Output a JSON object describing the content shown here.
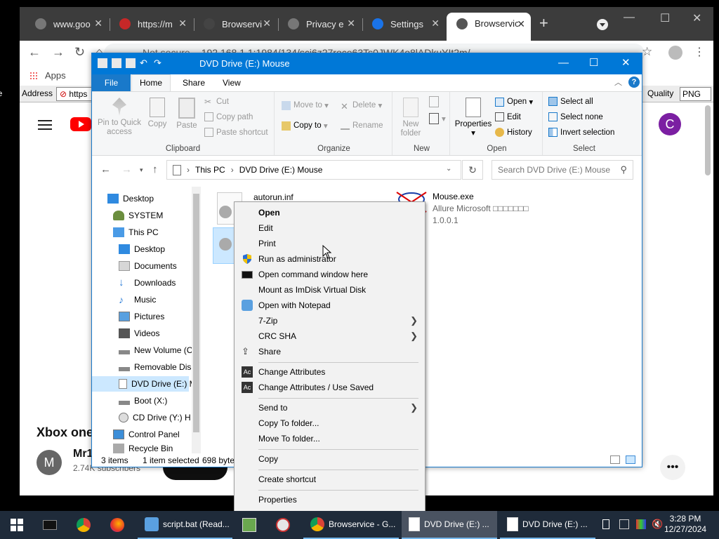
{
  "browser": {
    "tabs": [
      {
        "label": "www.goo",
        "favicon": "globe-icon"
      },
      {
        "label": "https://m",
        "favicon": "gmail-icon"
      },
      {
        "label": "Browservi",
        "favicon": "globe-icon"
      },
      {
        "label": "Privacy e",
        "favicon": "globe-icon"
      },
      {
        "label": "Settings",
        "favicon": "gear-icon"
      },
      {
        "label": "Browservic",
        "favicon": "globe-icon"
      }
    ],
    "security_label": "Not secure",
    "url": "192.168.1.1:1984/134/sci6z27roce63Ts0JWK4o8lADkuYIt2m/",
    "bookmarks_apps": "Apps",
    "page_address_label": "Address",
    "page_address_value": "https",
    "quality_label": "Quality",
    "quality_value": "PNG",
    "side_label": "Re"
  },
  "youtube": {
    "avatar_letter": "C",
    "video_title": "Xbox one",
    "channel_avatar_letter": "M",
    "channel_name": "Mr1",
    "channel_subs": "2.74K subscribers",
    "more_label": "•••"
  },
  "explorer": {
    "title": "DVD Drive (E:) Mouse",
    "ribbon_tabs": {
      "file": "File",
      "home": "Home",
      "share": "Share",
      "view": "View"
    },
    "clipboard": {
      "pin": "Pin to Quick access",
      "copy": "Copy",
      "paste": "Paste",
      "cut": "Cut",
      "copy_path": "Copy path",
      "paste_shortcut": "Paste shortcut",
      "group": "Clipboard"
    },
    "organize": {
      "move_to": "Move to",
      "copy_to": "Copy to",
      "delete": "Delete",
      "rename": "Rename",
      "group": "Organize"
    },
    "new": {
      "new_folder": "New folder",
      "group": "New"
    },
    "open": {
      "properties": "Properties",
      "open": "Open",
      "edit": "Edit",
      "history": "History",
      "group": "Open"
    },
    "select": {
      "select_all": "Select all",
      "select_none": "Select none",
      "invert": "Invert selection",
      "group": "Select"
    },
    "breadcrumb": [
      "This PC",
      "DVD Drive (E:) Mouse"
    ],
    "search_placeholder": "Search DVD Drive (E:) Mouse",
    "nav_items": [
      {
        "label": "Desktop",
        "icon": "desktop-icon"
      },
      {
        "label": "SYSTEM",
        "icon": "user-icon"
      },
      {
        "label": "This PC",
        "icon": "computer-icon"
      },
      {
        "label": "Desktop",
        "icon": "desktop-icon"
      },
      {
        "label": "Documents",
        "icon": "documents-icon"
      },
      {
        "label": "Downloads",
        "icon": "downloads-icon"
      },
      {
        "label": "Music",
        "icon": "music-icon"
      },
      {
        "label": "Pictures",
        "icon": "pictures-icon"
      },
      {
        "label": "Videos",
        "icon": "videos-icon"
      },
      {
        "label": "New Volume (C",
        "icon": "drive-icon"
      },
      {
        "label": "Removable Dis",
        "icon": "drive-icon"
      },
      {
        "label": "DVD Drive (E:) M",
        "icon": "dvd-icon"
      },
      {
        "label": "Boot (X:)",
        "icon": "drive-icon"
      },
      {
        "label": "CD Drive (Y:) H",
        "icon": "cd-icon"
      },
      {
        "label": "Control Panel",
        "icon": "control-panel-icon"
      },
      {
        "label": "Recycle Bin",
        "icon": "recycle-bin-icon"
      }
    ],
    "files": [
      {
        "name": "autorun.inf"
      },
      {
        "name": "Mouse.exe",
        "desc": "Allure Microsoft □□□□□□□",
        "version": "1.0.0.1"
      }
    ],
    "status": {
      "items": "3 items",
      "selected": "1 item selected",
      "size": "698 byte"
    }
  },
  "context_menu": {
    "items": [
      {
        "label": "Open",
        "bold": true
      },
      {
        "label": "Edit"
      },
      {
        "label": "Print"
      },
      {
        "label": "Run as administrator",
        "icon": "shield-icon"
      },
      {
        "label": "Open command window here",
        "icon": "cmd-icon"
      },
      {
        "label": "Mount as ImDisk Virtual Disk"
      },
      {
        "label": "Open with Notepad",
        "icon": "notepad-icon"
      },
      {
        "label": "7-Zip",
        "submenu": true
      },
      {
        "label": "CRC SHA",
        "submenu": true
      },
      {
        "label": "Share",
        "icon": "share-icon"
      },
      {
        "label": "Change Attributes",
        "icon": "attributes-icon"
      },
      {
        "label": "Change Attributes / Use Saved",
        "icon": "attributes-icon"
      },
      {
        "label": "Send to",
        "submenu": true
      },
      {
        "label": "Copy To folder..."
      },
      {
        "label": "Move To folder..."
      },
      {
        "label": "Copy"
      },
      {
        "label": "Create shortcut"
      },
      {
        "label": "Properties"
      }
    ]
  },
  "taskbar": {
    "items": [
      {
        "label": "script.bat (Read...",
        "icon": "notepad-icon"
      },
      {
        "label": "Browservice - G...",
        "icon": "chrome-icon"
      },
      {
        "label": "DVD Drive (E:) ...",
        "icon": "file-icon"
      },
      {
        "label": "DVD Drive (E:) ...",
        "icon": "file-icon"
      }
    ],
    "time": "3:28 PM",
    "date": "12/27/2024"
  },
  "colors": {
    "explorer_accent": "#0078d7",
    "taskbar_bg": "#1f2b3a",
    "chrome_tab_bg": "#3c3c3c"
  }
}
